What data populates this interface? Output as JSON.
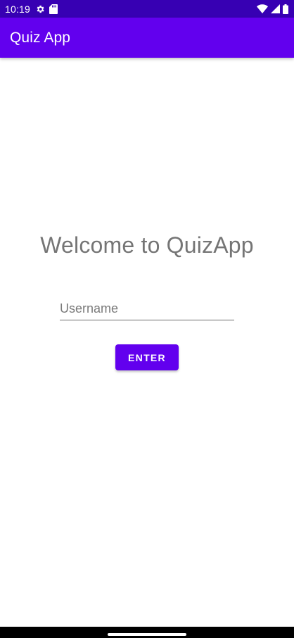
{
  "status_bar": {
    "time": "10:19",
    "left_icons": [
      "settings-icon",
      "sd-card-icon"
    ],
    "right_icons": [
      "wifi-icon",
      "signal-icon",
      "battery-icon"
    ],
    "background": "#3700b3"
  },
  "app_bar": {
    "title": "Quiz App",
    "background": "#6200ee"
  },
  "main": {
    "welcome_text": "Welcome to QuizApp",
    "username": {
      "placeholder": "Username",
      "value": ""
    },
    "enter_button_label": "ENTER"
  },
  "colors": {
    "primary": "#6200ee",
    "primary_dark": "#3700b3",
    "welcome_text": "#757575"
  }
}
